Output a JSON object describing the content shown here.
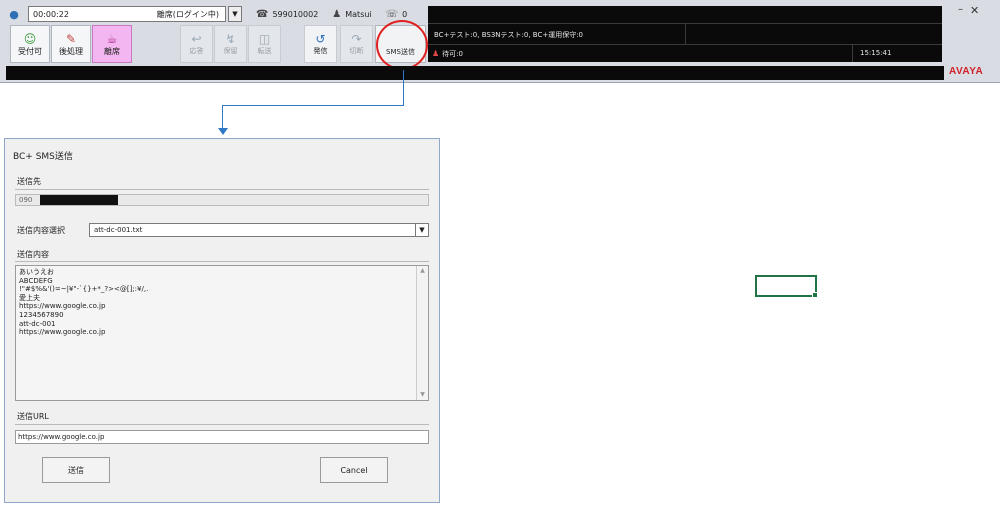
{
  "toolbar": {
    "timer": "00:00:22",
    "status_text": "離席(ログイン中)",
    "phone_number": "599010002",
    "user_name": "Matsui",
    "queue_count": "0",
    "state_buttons": [
      {
        "label": "受付可",
        "icon": "headset-icon"
      },
      {
        "label": "後処理",
        "icon": "after-call-icon"
      },
      {
        "label": "離席",
        "icon": "away-icon"
      }
    ],
    "call_buttons": [
      "応答",
      "保留",
      "転送",
      "発信",
      "切断"
    ],
    "sms_label": "SMS送信",
    "info_line": "BC+テスト:0, BS3Nテスト:0, BC+運用保守:0",
    "waiting_line": "待可:0",
    "clock": "15:15:41",
    "logo_text": "AVAYA"
  },
  "dialog": {
    "title": "BC+ SMS送信",
    "dest_label": "送信先",
    "dest_prefix": "090",
    "template_label": "送信内容選択",
    "template_value": "att-dc-001.txt",
    "content_label": "送信内容",
    "content_text": "あいうえお\nABCDEFG\n!\"#$%&'()=~|¥\"-`{}+*_?><@[];:¥/,.\n愛上夫\nhttps://www.google.co.jp\n1234567890\natt-dc-001\nhttps://www.google.co.jp",
    "url_label": "送信URL",
    "url_value": "https://www.google.co.jp",
    "send_button": "送信",
    "cancel_button": "Cancel"
  }
}
